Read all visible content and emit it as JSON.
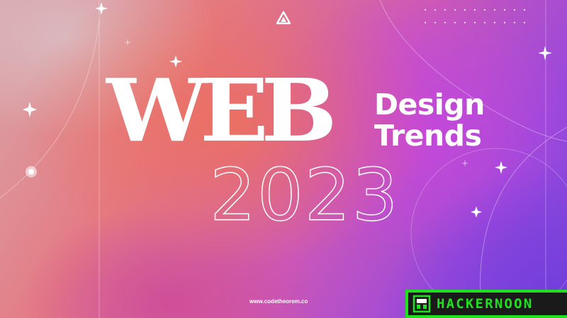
{
  "hero": {
    "title_main": "WEB",
    "title_side": [
      "Design",
      "Trends"
    ],
    "year": "2023"
  },
  "footer": {
    "website": "www.codetheorem.co"
  },
  "badge": {
    "label": "HACKERNOON",
    "color": "#1fe01f"
  },
  "icons": {
    "top_logo": "triangle-logo-icon",
    "badge_logo": "hackernoon-helmet-icon"
  },
  "colors": {
    "text": "#ffffff",
    "badge_background": "#1a1a1a"
  }
}
